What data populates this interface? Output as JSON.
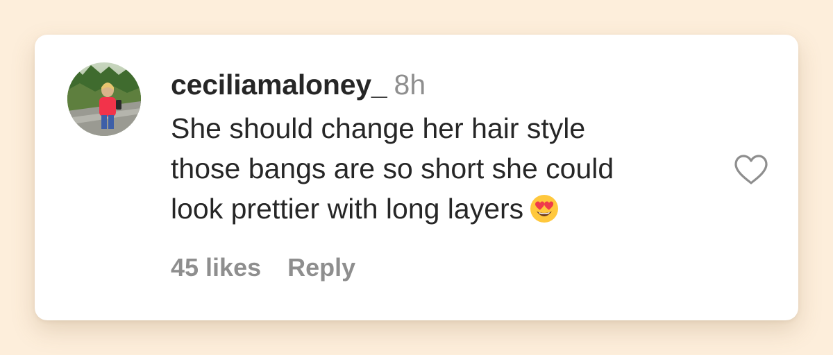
{
  "comment": {
    "username": "ceciliamaloney_",
    "timestamp": "8h",
    "lines": [
      "She should change her hair style",
      "those bangs are so short she could",
      "look prettier with long layers"
    ],
    "emoji": "heart-eyes-emoji"
  },
  "actions": {
    "likes_label": "45 likes",
    "reply_label": "Reply"
  },
  "icons": {
    "like": "heart-outline-icon",
    "avatar": "profile-photo"
  },
  "colors": {
    "background": "#fdeedb",
    "card": "#ffffff",
    "primary_text": "#262626",
    "secondary_text": "#8e8e8e"
  }
}
